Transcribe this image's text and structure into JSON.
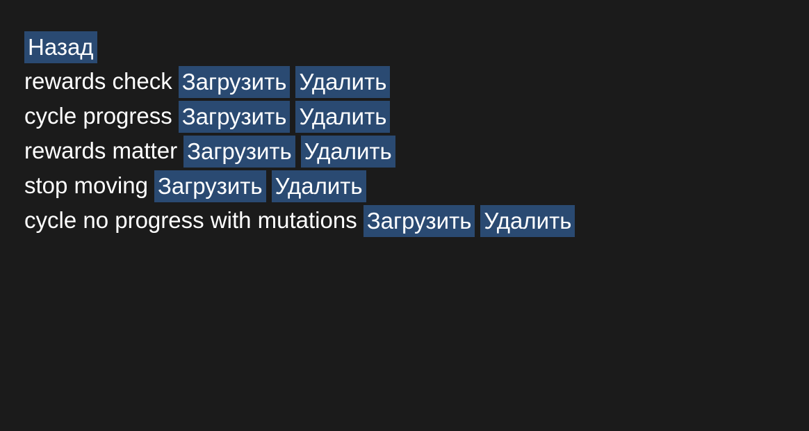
{
  "back_label": "Назад",
  "saves": [
    {
      "name": "rewards check",
      "load_label": "Загрузить",
      "delete_label": "Удалить"
    },
    {
      "name": "cycle progress",
      "load_label": "Загрузить",
      "delete_label": "Удалить"
    },
    {
      "name": "rewards matter",
      "load_label": "Загрузить",
      "delete_label": "Удалить"
    },
    {
      "name": "stop moving",
      "load_label": "Загрузить",
      "delete_label": "Удалить"
    },
    {
      "name": "cycle no progress with mutations",
      "load_label": "Загрузить",
      "delete_label": "Удалить"
    }
  ],
  "colors": {
    "background": "#1b1b1b",
    "button": "#2a4a72",
    "text": "#ffffff"
  }
}
